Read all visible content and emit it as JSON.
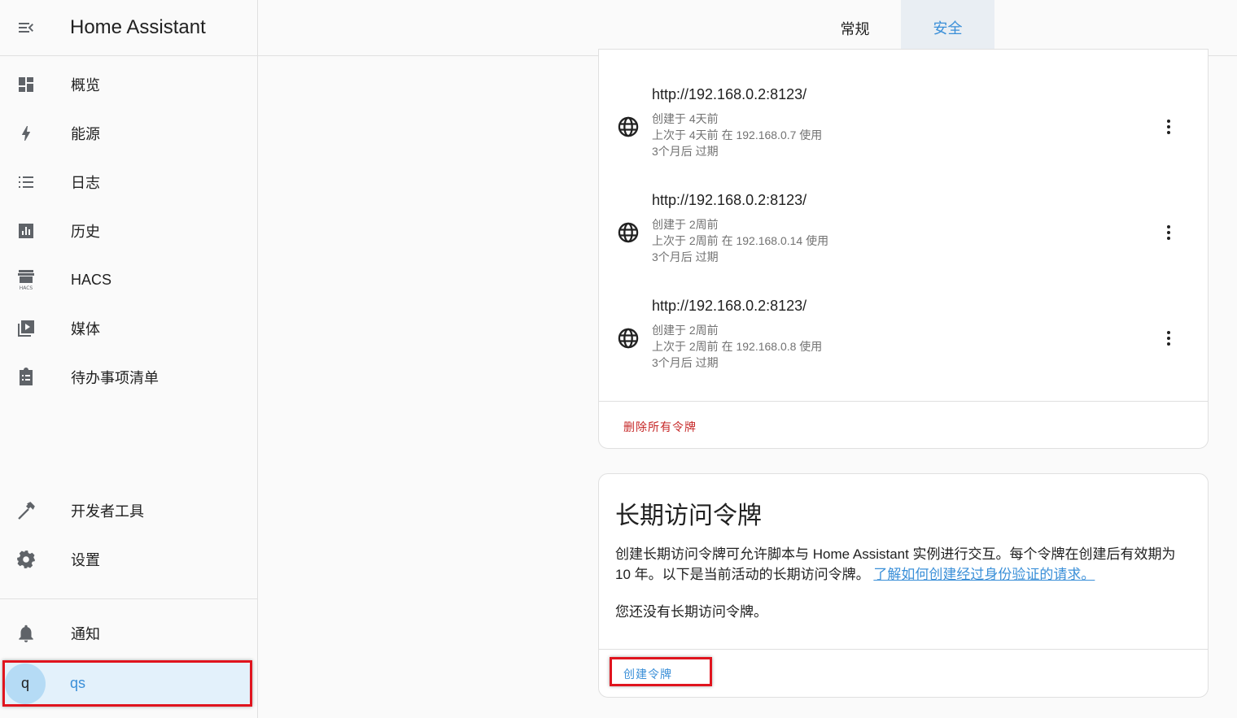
{
  "app": {
    "title": "Home Assistant"
  },
  "sidebar": {
    "items": [
      {
        "label": "概览",
        "icon": "dashboard-icon"
      },
      {
        "label": "能源",
        "icon": "lightning-icon"
      },
      {
        "label": "日志",
        "icon": "list-icon"
      },
      {
        "label": "历史",
        "icon": "chart-box-icon"
      },
      {
        "label": "HACS",
        "icon": "hacs-icon"
      },
      {
        "label": "媒体",
        "icon": "play-box-icon"
      },
      {
        "label": "待办事项清单",
        "icon": "clipboard-list-icon"
      },
      {
        "label": "开发者工具",
        "icon": "hammer-icon"
      },
      {
        "label": "设置",
        "icon": "gear-icon"
      },
      {
        "label": "通知",
        "icon": "bell-icon"
      }
    ],
    "user": {
      "avatar_initial": "q",
      "name": "qs"
    }
  },
  "tabs": [
    {
      "label": "常规",
      "active": false
    },
    {
      "label": "安全",
      "active": true
    }
  ],
  "refresh_tokens": {
    "items": [
      {
        "url": "http://192.168.0.2:8123/",
        "created": "创建于 4天前",
        "last_used": "上次于 4天前 在 192.168.0.7 使用",
        "expires": "3个月后 过期"
      },
      {
        "url": "http://192.168.0.2:8123/",
        "created": "创建于 2周前",
        "last_used": "上次于 2周前 在 192.168.0.14 使用",
        "expires": "3个月后 过期"
      },
      {
        "url": "http://192.168.0.2:8123/",
        "created": "创建于 2周前",
        "last_used": "上次于 2周前 在 192.168.0.8 使用",
        "expires": "3个月后 过期"
      }
    ],
    "delete_all_label": "删除所有令牌"
  },
  "long_lived": {
    "title": "长期访问令牌",
    "description": "创建长期访问令牌可允许脚本与 Home Assistant 实例进行交互。每个令牌在创建后有效期为 10 年。以下是当前活动的长期访问令牌。",
    "link_text": "了解如何创建经过身份验证的请求。",
    "empty_text": "您还没有长期访问令牌。",
    "create_label": "创建令牌"
  },
  "colors": {
    "accent": "#3a8fd8",
    "danger": "#c62828",
    "highlight": "#e0141e"
  }
}
